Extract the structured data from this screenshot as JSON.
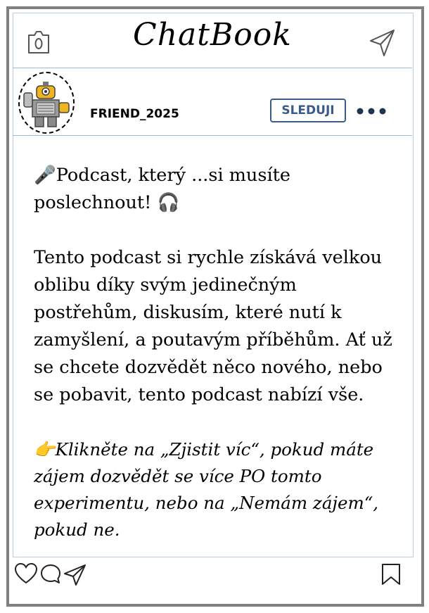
{
  "header": {
    "app_title": "ChatBook",
    "camera_icon": "camera-icon",
    "send_icon": "paper-plane-icon"
  },
  "user": {
    "username": "FRIEND_2025",
    "follow_label": "SLEDUJI",
    "more_icon": "three-dots-icon",
    "avatar": "robot-avatar"
  },
  "post": {
    "intro_emoji": "🎤",
    "intro_text": "Podcast, který ...si musíte poslechnout!",
    "intro_trailing_emoji": "🎧",
    "body_text": "Tento podcast si rychle získává velkou oblibu díky svým jedinečným postřehům, diskusím, které nutí k zamyšlení, a poutavým příběhům. Ať už se chcete dozvědět něco nového, nebo se pobavit, tento podcast nabízí vše.",
    "cta_emoji": "👉",
    "cta_text": "Klikněte na „Zjistit víc“, pokud máte zájem dozvědět se více PO tomto experimentu, nebo na „Nemám zájem“, pokud ne."
  },
  "footer": {
    "like_icon": "heart-icon",
    "comment_icon": "comment-icon",
    "share_icon": "paper-plane-icon",
    "save_icon": "bookmark-icon"
  },
  "colors": {
    "frame": "#808080",
    "divider": "#9db9d6",
    "follow": "#3a5a8a"
  }
}
